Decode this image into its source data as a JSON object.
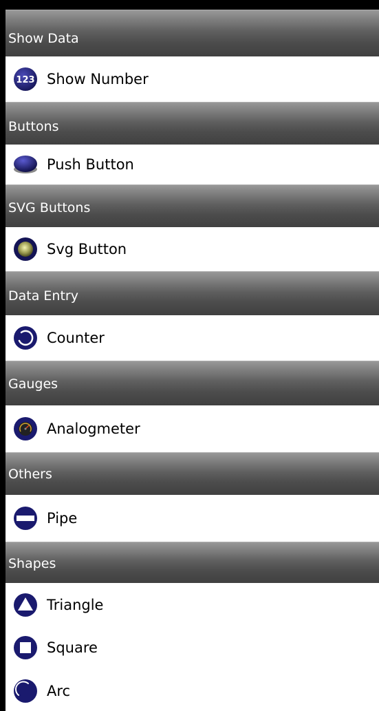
{
  "toolbox": {
    "categories": [
      {
        "title": "Show Data",
        "items": [
          {
            "label": "Show Number",
            "icon": "number-123-icon"
          }
        ]
      },
      {
        "title": "Buttons",
        "items": [
          {
            "label": "Push Button",
            "icon": "push-button-icon"
          }
        ]
      },
      {
        "title": "SVG Buttons",
        "items": [
          {
            "label": "Svg Button",
            "icon": "svg-button-icon"
          }
        ]
      },
      {
        "title": "Data Entry",
        "items": [
          {
            "label": "Counter",
            "icon": "counter-icon"
          }
        ]
      },
      {
        "title": "Gauges",
        "items": [
          {
            "label": "Analogmeter",
            "icon": "analogmeter-icon"
          }
        ]
      },
      {
        "title": "Others",
        "items": [
          {
            "label": "Pipe",
            "icon": "pipe-icon"
          }
        ]
      },
      {
        "title": "Shapes",
        "items": [
          {
            "label": "Triangle",
            "icon": "triangle-icon"
          },
          {
            "label": "Square",
            "icon": "square-icon"
          },
          {
            "label": "Arc",
            "icon": "arc-icon"
          }
        ]
      }
    ]
  },
  "colors": {
    "icon_navy": "#1a1a6e",
    "header_text": "#ffffff",
    "item_background": "#ffffff"
  }
}
